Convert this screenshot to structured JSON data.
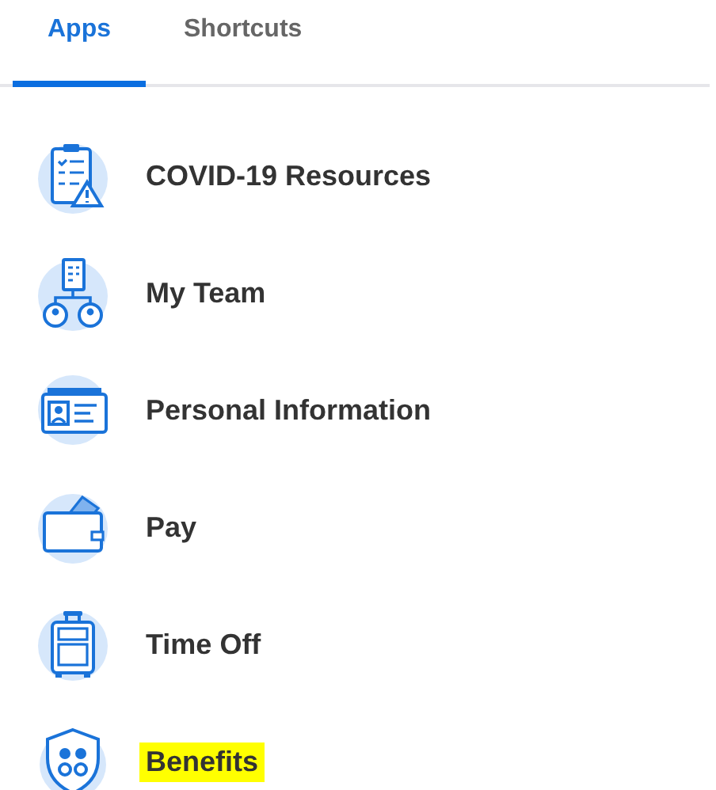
{
  "tabs": [
    {
      "label": "Apps",
      "selected": true
    },
    {
      "label": "Shortcuts",
      "selected": false
    }
  ],
  "apps": [
    {
      "label": "COVID-19 Resources",
      "kind": "clipboard",
      "highlighted": false
    },
    {
      "label": "My Team",
      "kind": "team",
      "highlighted": false
    },
    {
      "label": "Personal Information",
      "kind": "idcard",
      "highlighted": false
    },
    {
      "label": "Pay",
      "kind": "wallet",
      "highlighted": false
    },
    {
      "label": "Time Off",
      "kind": "suitcase",
      "highlighted": false
    },
    {
      "label": "Benefits",
      "kind": "shield",
      "highlighted": true
    }
  ]
}
